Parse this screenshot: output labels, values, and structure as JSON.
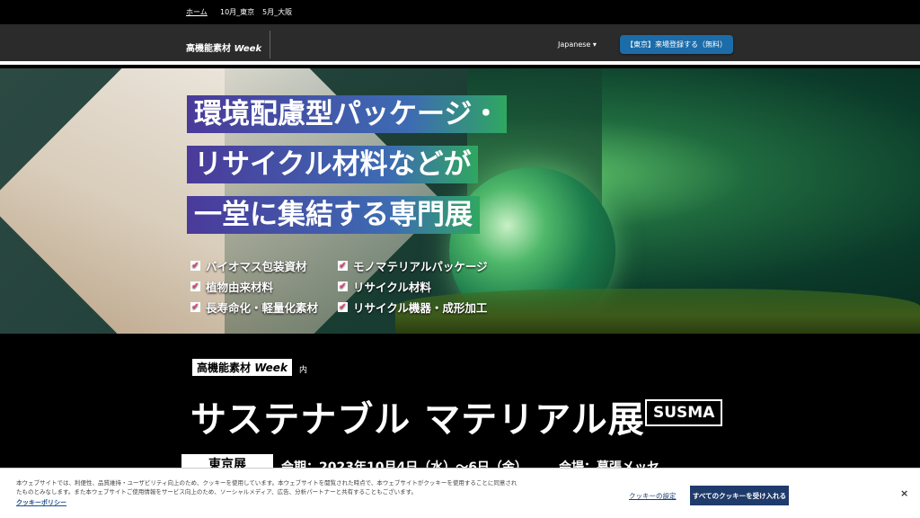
{
  "topbar": {
    "links": [
      "ホーム",
      "10月_東京",
      "5月_大阪"
    ]
  },
  "navbar": {
    "logo_main": "高機能素材",
    "logo_week": "Week",
    "language": "Japanese ▾",
    "register_label": "【東京】来場登録する（無料）"
  },
  "hero": {
    "headline_1": "環境配慮型パッケージ・",
    "headline_2": "リサイクル材料などが",
    "headline_3": "一堂に集結する専門展",
    "items": [
      "バイオマス包装資材",
      "植物由来材料",
      "長寿命化・軽量化素材",
      "モノマテリアルパッケージ",
      "リサイクル材料",
      "リサイクル機器・成形加工"
    ]
  },
  "event": {
    "badge_main": "高機能素材",
    "badge_week": "Week",
    "badge_suffix": "内",
    "title": "サステナブル マテリアル展",
    "abbr": "SUSMA",
    "tab_label": "東京展",
    "schedule": "会期：2023年10月4日（水）～6日（金）",
    "venue": "会場：幕張メッセ"
  },
  "cookie": {
    "text": "本ウェブサイトでは、利便性、品質維持・ユーザビリティ向上のため、クッキーを使用しています。本ウェブサイトを閲覧された時点で、本ウェブサイトがクッキーを使用することに同意されたものとみなします。また本ウェブサイトご使用情報をサービス向上のため、ソーシャルメディア、広告、分析パートナーと共有することもございます。",
    "policy_link": "クッキーポリシー",
    "settings_link": "クッキーの設定",
    "accept_label": "すべてのクッキーを受け入れる",
    "close_label": "×"
  }
}
